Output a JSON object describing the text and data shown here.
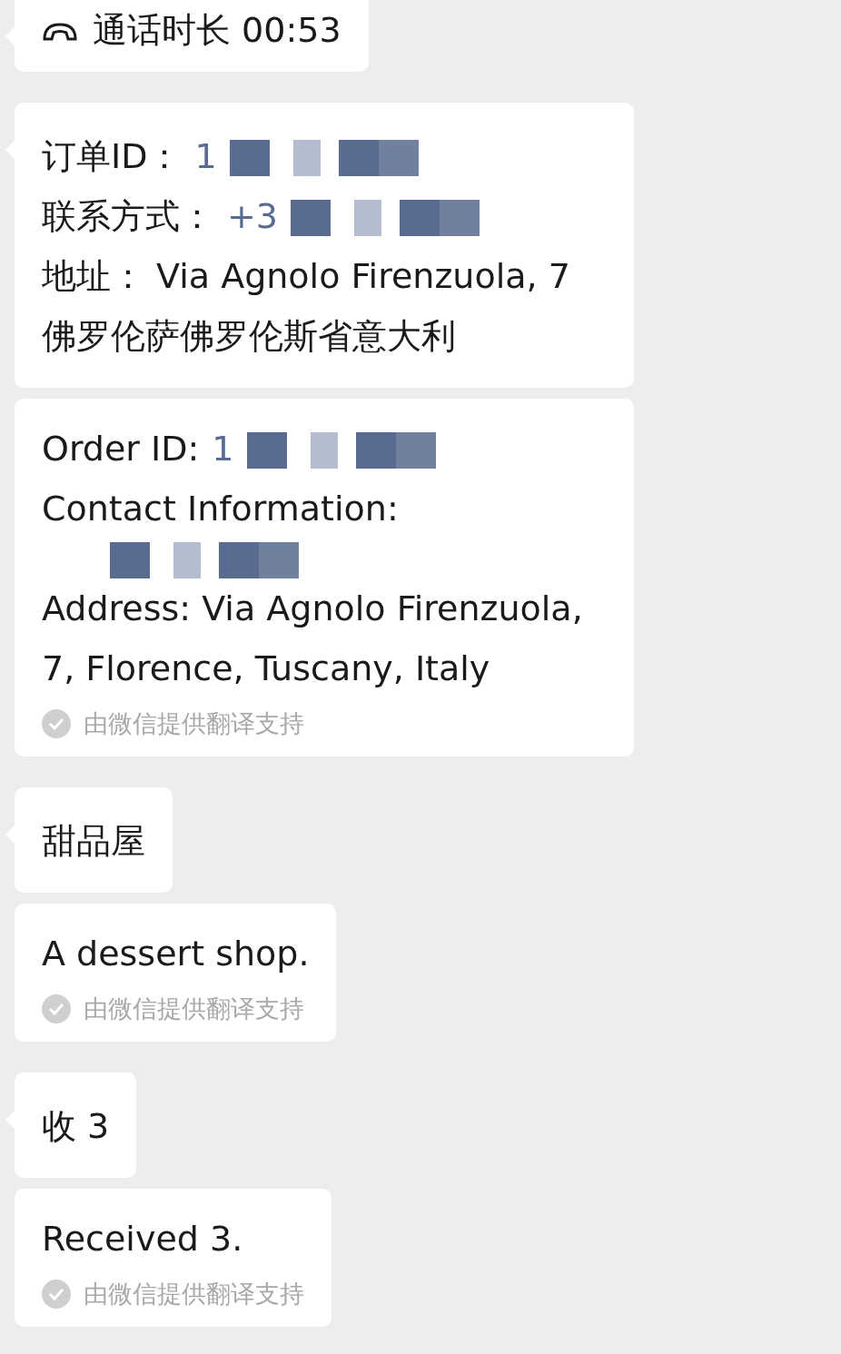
{
  "messages": [
    {
      "kind": "call",
      "text": "通话时长 00:53"
    },
    {
      "kind": "text",
      "lines": [
        {
          "label": "订单ID：",
          "value": "1",
          "redacted": true
        },
        {
          "label": "联系方式：",
          "value": "+3",
          "redacted": true
        },
        {
          "label": "地址：  Via Agnolo Firenzuola, 7 佛罗伦萨佛罗伦斯省意大利",
          "redacted": false
        }
      ]
    },
    {
      "kind": "translation",
      "lines": [
        {
          "label": "Order ID:",
          "value": "1",
          "redacted": true
        },
        {
          "label": "Contact Information:",
          "redacted": false
        },
        {
          "redacted": true
        },
        {
          "label": "Address: Via Agnolo Firenzuola, 7, Florence, Tuscany, Italy",
          "redacted": false
        }
      ],
      "footer": "由微信提供翻译支持"
    },
    {
      "kind": "text",
      "lines": [
        {
          "label": "甜品屋",
          "redacted": false
        }
      ]
    },
    {
      "kind": "translation",
      "lines": [
        {
          "label": "A dessert shop.",
          "redacted": false
        }
      ],
      "footer": "由微信提供翻译支持"
    },
    {
      "kind": "text",
      "lines": [
        {
          "label": "收 3",
          "redacted": false
        }
      ]
    },
    {
      "kind": "translation",
      "lines": [
        {
          "label": "Received 3.",
          "redacted": false
        }
      ],
      "footer": "由微信提供翻译支持"
    }
  ]
}
